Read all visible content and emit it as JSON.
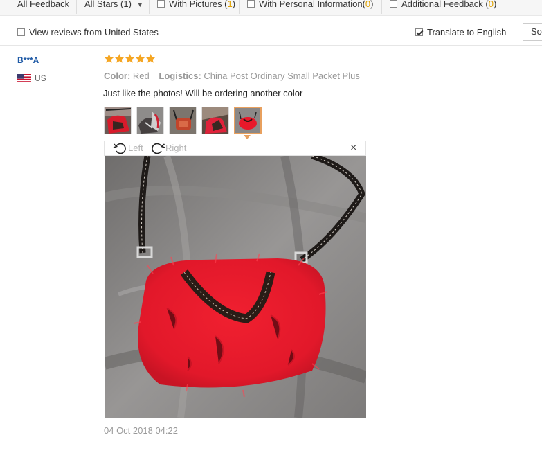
{
  "filters": {
    "all_feedback": "All Feedback",
    "all_stars": "All Stars (1)",
    "with_pictures_label": "With Pictures (",
    "with_pictures_count": "1",
    "with_personal_label": "With Personal Information(",
    "with_personal_count": "0",
    "additional_label": "Additional Feedback (",
    "additional_count": "0",
    "close_paren": ")"
  },
  "options": {
    "view_us_label": "View reviews from United States",
    "view_us_checked": false,
    "translate_label": "Translate to English",
    "translate_checked": true,
    "sort_label": "So"
  },
  "review": {
    "user": "B***A",
    "country": "US",
    "rating": 5,
    "color_label": "Color:",
    "color_value": "Red",
    "logistics_label": "Logistics:",
    "logistics_value": "China Post Ordinary Small Packet Plus",
    "text": "Just like the photos! Will be ordering another color",
    "thumbnails": [
      "thumbnail-1",
      "thumbnail-2",
      "thumbnail-3",
      "thumbnail-4",
      "thumbnail-5"
    ],
    "active_thumbnail": 5,
    "viewer": {
      "rotate_left_label": "Left",
      "rotate_right_label": "Right",
      "close_icon": "×"
    },
    "date": "04 Oct 2018 04:22"
  },
  "colors": {
    "star": "#f5a623",
    "username": "#1f5aa6",
    "count_highlight": "#e0a200",
    "active_border": "#e8a05e",
    "bag_red": "#e8182a"
  },
  "icons": {
    "rotate_left": "rotate-left-icon",
    "rotate_right": "rotate-right-icon",
    "close": "close-icon",
    "flag": "us-flag-icon",
    "star": "star-icon"
  }
}
